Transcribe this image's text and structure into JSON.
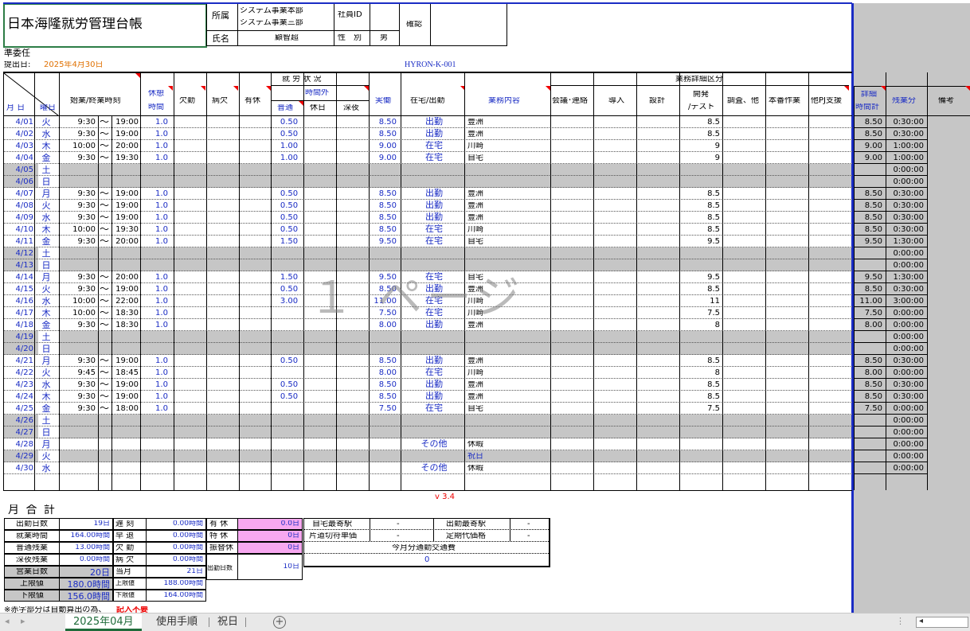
{
  "header": {
    "title": "日本海隆就労管理台帳",
    "dept_label": "所属",
    "dept_line1": "システム事業本部",
    "dept_line2": "システム事業三部",
    "name_label": "氏名",
    "name_value": "顧智超",
    "empid_label": "社員ID",
    "gender_label": "性　別",
    "gender_value": "男",
    "confirm_label": "確認",
    "status": "準委任",
    "submit_label": "提出日:",
    "submit_date": "2025年4月30日",
    "code": "HYRON-K-001"
  },
  "columns": {
    "date": "月 日",
    "weekday": "曜日",
    "hours": "始業/終業時刻",
    "rest_1": "休憩",
    "rest_2": "時間",
    "absent": "欠勤",
    "sick": "病欠",
    "paid": "有休",
    "work_status": "就 労 状 況",
    "overtime": "時間外",
    "ot_normal": "普通",
    "ot_holiday": "休日",
    "ot_night": "深夜",
    "actual": "実働",
    "location": "在宅/出勤",
    "content": "業務内容",
    "detail_title": "業務詳細区分",
    "meeting": "会議･連絡",
    "intro": "導入",
    "design": "設計",
    "dev_1": "開発",
    "dev_2": "/テスト",
    "research": "調査、他",
    "prod": "本番作業",
    "other_pj": "他PJ支援",
    "detail_total_1": "詳細",
    "detail_total_2": "時間計",
    "overtime_min": "残業分",
    "notes": "備考"
  },
  "rows": [
    {
      "date": "4/01",
      "wd": "火",
      "s": "9:30",
      "e": "19:00",
      "rest": "1.0",
      "ot": "0.50",
      "act": "8.50",
      "loc": "出勤",
      "cont": "豊洲",
      "dev": "8.5",
      "tot": "8.50",
      "otm": "0:30:00"
    },
    {
      "date": "4/02",
      "wd": "水",
      "s": "9:30",
      "e": "19:00",
      "rest": "1.0",
      "ot": "0.50",
      "act": "8.50",
      "loc": "出勤",
      "cont": "豊洲",
      "dev": "8.5",
      "tot": "8.50",
      "otm": "0:30:00"
    },
    {
      "date": "4/03",
      "wd": "木",
      "s": "10:00",
      "e": "20:00",
      "rest": "1.0",
      "ot": "1.00",
      "act": "9.00",
      "loc": "在宅",
      "cont": "川崎",
      "dev": "9",
      "tot": "9.00",
      "otm": "1:00:00"
    },
    {
      "date": "4/04",
      "wd": "金",
      "s": "9:30",
      "e": "19:30",
      "rest": "1.0",
      "ot": "1.00",
      "act": "9.00",
      "loc": "在宅",
      "cont": "自宅",
      "dev": "9",
      "tot": "9.00",
      "otm": "1:00:00"
    },
    {
      "date": "4/05",
      "wd": "土",
      "off": true,
      "otm": "0:00:00"
    },
    {
      "date": "4/06",
      "wd": "日",
      "off": true,
      "otm": "0:00:00"
    },
    {
      "date": "4/07",
      "wd": "月",
      "s": "9:30",
      "e": "19:00",
      "rest": "1.0",
      "ot": "0.50",
      "act": "8.50",
      "loc": "出勤",
      "cont": "豊洲",
      "dev": "8.5",
      "tot": "8.50",
      "otm": "0:30:00"
    },
    {
      "date": "4/08",
      "wd": "火",
      "s": "9:30",
      "e": "19:00",
      "rest": "1.0",
      "ot": "0.50",
      "act": "8.50",
      "loc": "出勤",
      "cont": "豊洲",
      "dev": "8.5",
      "tot": "8.50",
      "otm": "0:30:00"
    },
    {
      "date": "4/09",
      "wd": "水",
      "s": "9:30",
      "e": "19:00",
      "rest": "1.0",
      "ot": "0.50",
      "act": "8.50",
      "loc": "出勤",
      "cont": "豊洲",
      "dev": "8.5",
      "tot": "8.50",
      "otm": "0:30:00"
    },
    {
      "date": "4/10",
      "wd": "木",
      "s": "10:00",
      "e": "19:30",
      "rest": "1.0",
      "ot": "0.50",
      "act": "8.50",
      "loc": "在宅",
      "cont": "川崎",
      "dev": "8.5",
      "tot": "8.50",
      "otm": "0:30:00"
    },
    {
      "date": "4/11",
      "wd": "金",
      "s": "9:30",
      "e": "20:00",
      "rest": "1.0",
      "ot": "1.50",
      "act": "9.50",
      "loc": "在宅",
      "cont": "自宅",
      "dev": "9.5",
      "tot": "9.50",
      "otm": "1:30:00"
    },
    {
      "date": "4/12",
      "wd": "土",
      "off": true,
      "otm": "0:00:00"
    },
    {
      "date": "4/13",
      "wd": "日",
      "off": true,
      "otm": "0:00:00"
    },
    {
      "date": "4/14",
      "wd": "月",
      "s": "9:30",
      "e": "20:00",
      "rest": "1.0",
      "ot": "1.50",
      "act": "9.50",
      "loc": "在宅",
      "cont": "自宅",
      "dev": "9.5",
      "tot": "9.50",
      "otm": "1:30:00"
    },
    {
      "date": "4/15",
      "wd": "火",
      "s": "9:30",
      "e": "19:00",
      "rest": "1.0",
      "ot": "0.50",
      "act": "8.50",
      "loc": "出勤",
      "cont": "豊洲",
      "dev": "8.5",
      "tot": "8.50",
      "otm": "0:30:00"
    },
    {
      "date": "4/16",
      "wd": "水",
      "s": "10:00",
      "e": "22:00",
      "rest": "1.0",
      "ot": "3.00",
      "act": "11.00",
      "loc": "在宅",
      "cont": "川崎",
      "dev": "11",
      "tot": "11.00",
      "otm": "3:00:00"
    },
    {
      "date": "4/17",
      "wd": "木",
      "s": "10:00",
      "e": "18:30",
      "rest": "1.0",
      "ot": "",
      "act": "7.50",
      "loc": "在宅",
      "cont": "川崎",
      "dev": "7.5",
      "tot": "7.50",
      "otm": "0:00:00"
    },
    {
      "date": "4/18",
      "wd": "金",
      "s": "9:30",
      "e": "18:30",
      "rest": "1.0",
      "ot": "",
      "act": "8.00",
      "loc": "出勤",
      "cont": "豊洲",
      "dev": "8",
      "tot": "8.00",
      "otm": "0:00:00"
    },
    {
      "date": "4/19",
      "wd": "土",
      "off": true,
      "otm": "0:00:00"
    },
    {
      "date": "4/20",
      "wd": "日",
      "off": true,
      "otm": "0:00:00"
    },
    {
      "date": "4/21",
      "wd": "月",
      "s": "9:30",
      "e": "19:00",
      "rest": "1.0",
      "ot": "0.50",
      "act": "8.50",
      "loc": "出勤",
      "cont": "豊洲",
      "dev": "8.5",
      "tot": "8.50",
      "otm": "0:30:00"
    },
    {
      "date": "4/22",
      "wd": "火",
      "s": "9:45",
      "e": "18:45",
      "rest": "1.0",
      "ot": "",
      "act": "8.00",
      "loc": "在宅",
      "cont": "川崎",
      "dev": "8",
      "tot": "8.00",
      "otm": "0:00:00"
    },
    {
      "date": "4/23",
      "wd": "水",
      "s": "9:30",
      "e": "19:00",
      "rest": "1.0",
      "ot": "0.50",
      "act": "8.50",
      "loc": "出勤",
      "cont": "豊洲",
      "dev": "8.5",
      "tot": "8.50",
      "otm": "0:30:00"
    },
    {
      "date": "4/24",
      "wd": "木",
      "s": "9:30",
      "e": "19:00",
      "rest": "1.0",
      "ot": "0.50",
      "act": "8.50",
      "loc": "出勤",
      "cont": "豊洲",
      "dev": "8.5",
      "tot": "8.50",
      "otm": "0:30:00"
    },
    {
      "date": "4/25",
      "wd": "金",
      "s": "9:30",
      "e": "18:00",
      "rest": "1.0",
      "ot": "",
      "act": "7.50",
      "loc": "在宅",
      "cont": "自宅",
      "dev": "7.5",
      "tot": "7.50",
      "otm": "0:00:00"
    },
    {
      "date": "4/26",
      "wd": "土",
      "off": true,
      "otm": "0:00:00"
    },
    {
      "date": "4/27",
      "wd": "日",
      "off": true,
      "otm": "0:00:00"
    },
    {
      "date": "4/28",
      "wd": "月",
      "s": "",
      "e": "",
      "rest": "",
      "ot": "",
      "act": "",
      "loc": "その他",
      "cont": "休暇",
      "dev": "",
      "tot": "",
      "otm": "0:00:00"
    },
    {
      "date": "4/29",
      "wd": "火",
      "off": true,
      "offcont": "祝日",
      "otm": "0:00:00"
    },
    {
      "date": "4/30",
      "wd": "水",
      "s": "",
      "e": "",
      "rest": "",
      "ot": "",
      "act": "",
      "loc": "その他",
      "cont": "休暇",
      "dev": "",
      "tot": "",
      "otm": "0:00:00"
    }
  ],
  "tilde": "～",
  "watermark": "１ ページ",
  "version": "v 3.4",
  "summary": {
    "title": "月 合 計",
    "left": [
      {
        "label": "出勤日数",
        "value": "19日"
      },
      {
        "label": "就業時間",
        "value": "164.00時間"
      },
      {
        "label": "普通残業",
        "value": "13.00時間"
      },
      {
        "label": "深夜残業",
        "value": "0.00時間"
      },
      {
        "label": "営業日数",
        "value": "20日"
      },
      {
        "label": "上限値",
        "value": "180.0時間"
      },
      {
        "label": "下限値",
        "value": "156.0時間"
      }
    ],
    "mid": [
      {
        "label": "遅 刻",
        "value": "0.00時間"
      },
      {
        "label": "早 退",
        "value": "0.00時間"
      },
      {
        "label": "欠 勤",
        "value": "0.00時間"
      },
      {
        "label": "病 欠",
        "value": "0.00時間"
      },
      {
        "label": "当月",
        "value": "21日"
      },
      {
        "label": "上限値",
        "value": "188.00時間"
      },
      {
        "label": "下限値",
        "value": "164.00時間"
      }
    ],
    "leave": [
      {
        "label": "有 休",
        "value": "0.0日"
      },
      {
        "label": "特 休",
        "value": "0日"
      },
      {
        "label": "振替休",
        "value": "0日"
      }
    ],
    "work_days_label": "出勤日数",
    "work_days_value": "10日",
    "station_home_label": "自宅最寄駅",
    "station_home_value": "-",
    "station_work_label": "出勤最寄駅",
    "station_work_value": "-",
    "fare_label": "片道切符単価",
    "fare_value": "-",
    "pass_label": "定期代価格",
    "pass_value": "-",
    "commute_label": "今月分通勤交通費",
    "commute_value": "0",
    "footnote": "※赤字部分は自動算出の為、",
    "footnote_red": "記入不要"
  },
  "tabs": {
    "active": "2025年04月",
    "t2": "使用手順",
    "t3": "祝日",
    "add": "+"
  }
}
